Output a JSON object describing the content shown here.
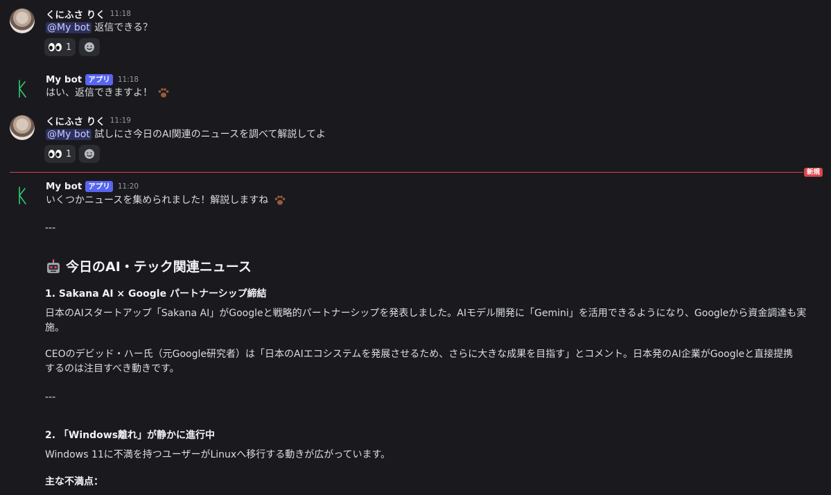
{
  "messages": [
    {
      "username": "くにふさ りく",
      "time": "11:18",
      "mention": "@My bot",
      "text": "返信できる？",
      "reaction_count": "1"
    },
    {
      "username": "My bot",
      "badge": "アプリ",
      "time": "11:18",
      "text": "はい、返信できますよ！"
    },
    {
      "username": "くにふさ りく",
      "time": "11:19",
      "mention": "@My bot",
      "text": "試しにさ今日のAI関連のニュースを調べて解説してよ",
      "reaction_count": "1"
    },
    {
      "username": "My bot",
      "badge": "アプリ",
      "time": "11:20",
      "text": "いくつかニュースを集められました！解説しますね"
    }
  ],
  "new_divider_label": "新規",
  "article": {
    "sep1": "---",
    "heading": "今日のAI・テック関連ニュース",
    "item1_title": "1. Sakana AI × Google パートナーシップ締結",
    "item1_p1_line1": "日本のAIスタートアップ「Sakana AI」がGoogleと戦略的パートナーシップを発表しました。AIモデル開発に「Gemini」を活用できるようになり、Googleから資金調達も実",
    "item1_p1_line2": "施。",
    "item1_p2_line1": "CEOのデビッド・ハー氏（元Google研究者）は「日本のAIエコシステムを発展させるため、さらに大きな成果を目指す」とコメント。日本発のAI企業がGoogleと直接提携",
    "item1_p2_line2": "するのは注目すべき動きです。",
    "sep2": "---",
    "item2_title": "2. 「Windows離れ」が静かに進行中",
    "item2_p1": "Windows 11に不満を持つユーザーがLinuxへ移行する動きが広がっています。",
    "item2_sub": "主な不満点："
  }
}
